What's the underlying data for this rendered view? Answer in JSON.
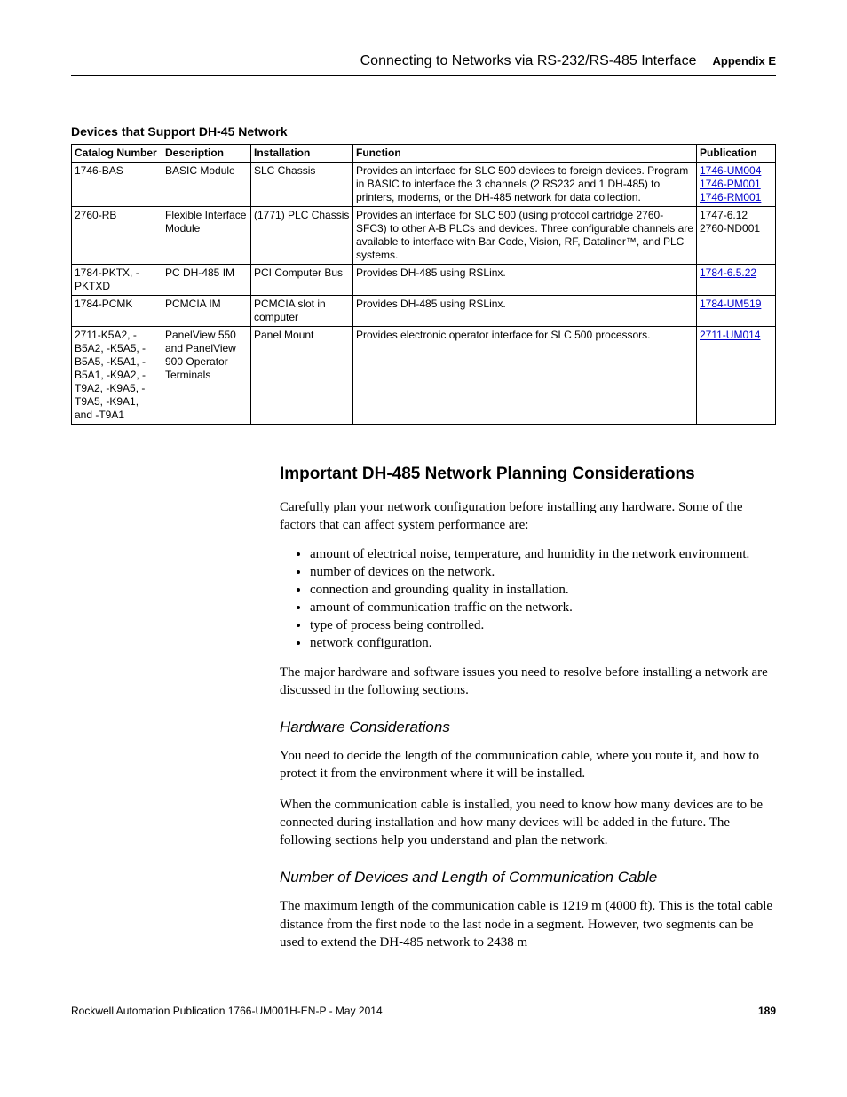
{
  "header": {
    "title": "Connecting to Networks via RS-232/RS-485 Interface",
    "appendix": "Appendix E"
  },
  "table": {
    "title": "Devices that Support DH-45 Network",
    "columns": {
      "catalog": "Catalog Number",
      "description": "Description",
      "installation": "Installation",
      "function": "Function",
      "publication": "Publication"
    },
    "rows": [
      {
        "catalog": "1746-BAS",
        "description": "BASIC Module",
        "installation": "SLC Chassis",
        "function": "Provides an interface for SLC 500 devices to foreign devices. Program in BASIC to interface the 3 channels (2 RS232 and 1 DH-485) to printers, modems, or the DH-485 network for data collection.",
        "pubs": [
          {
            "text": "1746-UM004",
            "link": true
          },
          {
            "text": "1746-PM001",
            "link": true
          },
          {
            "text": "1746-RM001",
            "link": true
          }
        ]
      },
      {
        "catalog": "2760-RB",
        "description": "Flexible Interface Module",
        "installation": "(1771) PLC Chassis",
        "function": "Provides an interface for SLC 500 (using protocol cartridge 2760-SFC3) to other A-B PLCs and devices. Three configurable channels are available to interface with Bar Code, Vision, RF, Dataliner™, and PLC systems.",
        "pubs": [
          {
            "text": "1747-6.12",
            "link": false
          },
          {
            "text": "2760-ND001",
            "link": false
          }
        ]
      },
      {
        "catalog": "1784-PKTX, -PKTXD",
        "description": "PC DH-485 IM",
        "installation": "PCI Computer Bus",
        "function": "Provides DH-485 using RSLinx.",
        "pubs": [
          {
            "text": "1784-6.5.22",
            "link": true
          }
        ]
      },
      {
        "catalog": "1784-PCMK",
        "description": "PCMCIA IM",
        "installation": "PCMCIA slot in computer",
        "function": "Provides DH-485 using RSLinx.",
        "pubs": [
          {
            "text": "1784-UM519",
            "link": true
          }
        ]
      },
      {
        "catalog": "2711-K5A2, -B5A2, -K5A5, -B5A5, -K5A1, -B5A1, -K9A2, -T9A2, -K9A5, -T9A5, -K9A1, and -T9A1",
        "description": "PanelView 550 and PanelView 900 Operator Terminals",
        "installation": "Panel Mount",
        "function": "Provides electronic operator interface for SLC 500 processors.",
        "pubs": [
          {
            "text": "2711-UM014",
            "link": true
          }
        ]
      }
    ]
  },
  "section": {
    "heading": "Important DH-485 Network Planning Considerations",
    "intro": "Carefully plan your network configuration before installing any hardware. Some of the factors that can affect system performance are:",
    "factors": [
      "amount of electrical noise, temperature, and humidity in the network environment.",
      "number of devices on the network.",
      "connection and grounding quality in installation.",
      "amount of communication traffic on the network.",
      "type of process being controlled.",
      "network configuration."
    ],
    "after_list": "The major hardware and software issues you need to resolve before installing a network are discussed in the following sections.",
    "hw_heading": "Hardware Considerations",
    "hw_p1": "You need to decide the length of the communication cable, where you route it, and how to protect it from the environment where it will be installed.",
    "hw_p2": "When the communication cable is installed, you need to know how many devices are to be connected during installation and how many devices will be added in the future. The following sections help you understand and plan the network.",
    "num_heading": "Number of Devices and Length of Communication Cable",
    "num_p1": "The maximum length of the communication cable is 1219 m (4000 ft). This is the total cable distance from the first node to the last node in a segment. However, two segments can be used to extend the DH-485 network to 2438 m"
  },
  "footer": {
    "left": "Rockwell Automation Publication 1766-UM001H-EN-P - May 2014",
    "right": "189"
  }
}
